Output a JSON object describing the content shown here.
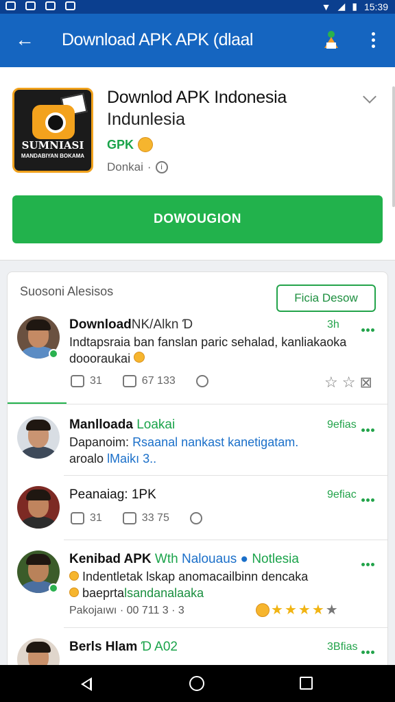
{
  "status_bar": {
    "time": "15:39"
  },
  "app_bar": {
    "title": "Download APK APK (dlaal"
  },
  "app": {
    "name_line1": "Downlod APK Indonesia",
    "name_line2": "Indunlesia",
    "tag": "GPK",
    "meta": "Donkai",
    "icon_text": "SUMNIASI",
    "icon_subtext": "MANDABIYAN BOKAMA",
    "install_label": "DOWOUGION"
  },
  "feed": {
    "header": "Suosoni Alesisos",
    "follow_label": "Ficia Desow",
    "posts": [
      {
        "author": "Download",
        "author_rest": "NK/Alkn Ɗ",
        "time": "3h",
        "line1": "Indtapsraia ban fanslan paric sehalad, kanliakaoka",
        "line2": "doooraukai",
        "likes": "31",
        "reposts": "67 133"
      },
      {
        "author": "Manlloada",
        "author_tag": "Loakai",
        "time": "9efias",
        "line1_prefix": "Dapanoim:",
        "line1_link": "Rsaanal nankast kanetigatam.",
        "line2_prefix": "aroalo",
        "line2_link": "lMaikı",
        "line2_suffix": "3.."
      },
      {
        "author": "Peanaiag: 1PK",
        "time": "9efiac",
        "likes": "31",
        "reposts": "33 75"
      },
      {
        "author": "Kenibad APK",
        "author_tag": "Wth",
        "author_link": "Nalouaus",
        "author_tag2": "Notlesia",
        "line1": "Indentletak lskap anomacailbinn dencaka",
        "line2_prefix": "baeprta",
        "line2_link": "lsandanalaaka",
        "meta": "Pakojaıwı · 00 711 3 · 3"
      },
      {
        "author": "Berls Hlam",
        "author_rest": "Ɗ A02",
        "time": "3Bfias"
      }
    ]
  },
  "colors": {
    "appbar": "#1565c0",
    "accent_green": "#22b24c",
    "link_blue": "#1a6fc9"
  }
}
